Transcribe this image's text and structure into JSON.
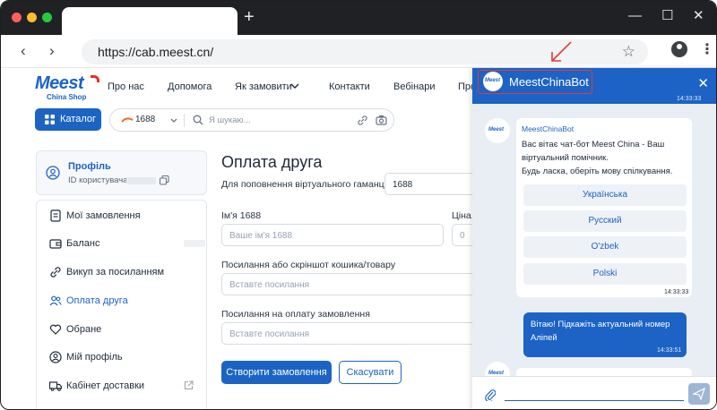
{
  "browser": {
    "url": "https://cab.meest.cn/",
    "new_tab_glyph": "+",
    "window_controls": [
      "—",
      "☐",
      "✕"
    ]
  },
  "site": {
    "logo_text": "Meest",
    "logo_sub": "China Shop",
    "nav": [
      "Про нас",
      "Допомога",
      "Як замовити",
      "Контакти",
      "Вебінари",
      "Про"
    ],
    "catalog_label": "Каталог",
    "search": {
      "value": "1688",
      "placeholder": "Я шукаю..."
    }
  },
  "profile": {
    "title": "Профіль",
    "user_id_label": "ID користувача:"
  },
  "menu": [
    {
      "label": "Мої замовлення",
      "icon": "orders-icon"
    },
    {
      "label": "Баланс",
      "icon": "wallet-icon"
    },
    {
      "label": "Викуп за посиланням",
      "icon": "link-icon"
    },
    {
      "label": "Оплата друга",
      "icon": "friends-icon",
      "active": true
    },
    {
      "label": "Обране",
      "icon": "heart-icon"
    },
    {
      "label": "Мій профіль",
      "icon": "user-icon"
    },
    {
      "label": "Кабінет доставки",
      "icon": "truck-icon"
    }
  ],
  "form": {
    "title": "Оплата друга",
    "wallet_label": "Для поповнення віртуального гаманця",
    "wallet_value": "1688",
    "name_label": "Ім'я 1688",
    "name_placeholder": "Ваше ім'я 1688",
    "price_label": "Ціна,",
    "price_value": "0",
    "cart_label": "Посилання або скріншот кошика/товару",
    "cart_placeholder": "Вставте посилання",
    "pay_label": "Посилання на оплату замовлення",
    "pay_placeholder": "Вставте посилання",
    "submit": "Створити замовлення",
    "cancel": "Скасувати"
  },
  "chat": {
    "title": "MeestChinaBot",
    "top_time": "14:33:33",
    "bot_name": "MeestChinaBot",
    "greeting": "Вас вітає чат-бот Meest China - Ваш віртуальний помічник.",
    "prompt": "Будь ласка, оберіть мову спілкування.",
    "languages": [
      "Українська",
      "Русский",
      "O'zbek",
      "Polski"
    ],
    "lang_time": "14:33:33",
    "user_message": "Вітаю! Підкажіть актуальний номер Аліпей",
    "user_time": "14:33:51",
    "avatar_text": "Meest"
  },
  "colors": {
    "brand_blue": "#1c64c4",
    "chat_header": "#1d63c5",
    "highlight_red": "#e03a3a"
  }
}
